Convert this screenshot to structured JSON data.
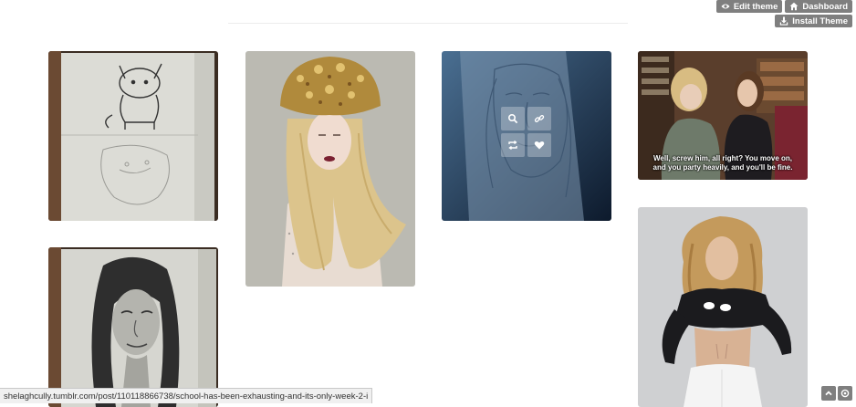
{
  "toolbar": {
    "edit_theme_label": "Edit theme",
    "dashboard_label": "Dashboard",
    "install_theme_label": "Install Theme"
  },
  "posts": [
    {
      "name": "sketchbook-creature-drawing",
      "kind": "photo"
    },
    {
      "name": "model-golden-crown-photo",
      "kind": "photo"
    },
    {
      "name": "pencil-portrait-hover",
      "kind": "photo",
      "hovered": true
    },
    {
      "name": "tv-scene-library",
      "kind": "photo",
      "caption_line1": "Well, screw him, all right? You move on,",
      "caption_line2": "and you party heavily, and you'll be fine."
    },
    {
      "name": "sketchbook-woman-portrait",
      "kind": "photo"
    },
    {
      "name": "model-crop-top-photo",
      "kind": "photo"
    }
  ],
  "hover_actions": [
    "zoom",
    "permalink",
    "reblog",
    "like"
  ],
  "status_url": "shelaghcully.tumblr.com/post/110118866738/school-has-been-exhausting-and-its-only-week-2-i",
  "colors": {
    "toolbar_bg": "#7f7f7f",
    "hover_overlay": "#2a4f74"
  }
}
